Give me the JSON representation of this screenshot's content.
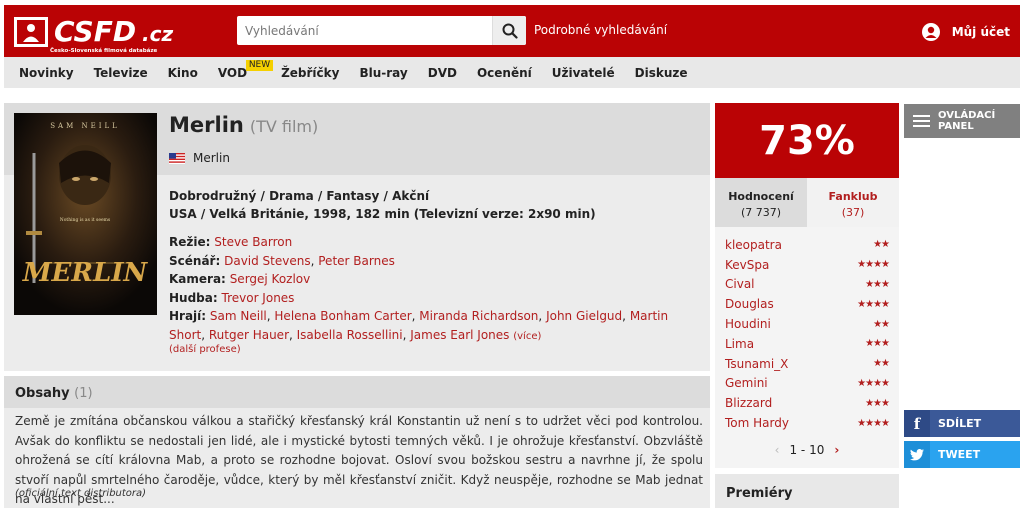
{
  "header": {
    "logo_text": "CSFD.cz",
    "logo_subtitle": "Česko-Slovenská filmová databáze",
    "search_placeholder": "Vyhledávání",
    "advanced_search": "Podrobné vyhledávání",
    "account": "Můj účet",
    "brand_color": "#ba0305"
  },
  "nav": {
    "items": [
      "Novinky",
      "Televize",
      "Kino",
      "VOD",
      "Žebříčky",
      "Blu-ray",
      "DVD",
      "Ocenění",
      "Uživatelé",
      "Diskuze"
    ],
    "vod_badge": "NEW"
  },
  "film": {
    "title": "Merlin",
    "type": "(TV film)",
    "original_name": "Merlin",
    "original_flag": "us-flag",
    "genres": "Dobrodružný / Drama / Fantasy / Akční",
    "origin": "USA / Velká Británie, 1998, 182 min (Televizní verze: 2x90 min)",
    "poster_actor": "SAM NEILL",
    "poster_title": "MERLIN",
    "poster_tagline": "Nothing is as it seems",
    "director_label": "Režie:",
    "directors": [
      "Steve Barron"
    ],
    "writer_label": "Scénář:",
    "writers": [
      "David Stevens",
      "Peter Barnes"
    ],
    "camera_label": "Kamera:",
    "camera": [
      "Sergej Kozlov"
    ],
    "music_label": "Hudba:",
    "music": [
      "Trevor Jones"
    ],
    "cast_label": "Hrají:",
    "cast": [
      "Sam Neill",
      "Helena Bonham Carter",
      "Miranda Richardson",
      "John Gielgud",
      "Martin Short",
      "Rutger Hauer",
      "Isabella Rossellini",
      "James Earl Jones"
    ],
    "cast_more": "(více)",
    "more_professions": "(další profese)"
  },
  "plot": {
    "title": "Obsahy",
    "count": "(1)",
    "text": "Země je zmítána občanskou válkou a stařičký křesťanský král Konstantin už není s to udržet věci pod kontrolou. Avšak do konfliktu se nedostali jen lidé, ale i mystické bytosti temných věků. I je ohrožuje křesťanství. Obzvláště ohrožená se cítí královna Mab, a proto se rozhodne bojovat. Osloví svou božskou sestru a navrhne jí, že spolu stvoří napůl smrtelného čaroděje, vůdce, který by měl křesťanství zničit. Když neuspěje, rozhodne se Mab jednat na vlastní pěst...",
    "source": "(oficiální text distributora)"
  },
  "rating": {
    "percent": "73%",
    "tab_ratings": "Hodnocení",
    "tab_ratings_count": "(7 737)",
    "tab_fanclub": "Fanklub",
    "tab_fanclub_count": "(37)",
    "users": [
      {
        "name": "kleopatra",
        "stars": "★★"
      },
      {
        "name": "KevSpa",
        "stars": "★★★★"
      },
      {
        "name": "Cival",
        "stars": "★★★"
      },
      {
        "name": "Douglas",
        "stars": "★★★★"
      },
      {
        "name": "Houdini",
        "stars": "★★"
      },
      {
        "name": "Lima",
        "stars": "★★★"
      },
      {
        "name": "Tsunami_X",
        "stars": "★★"
      },
      {
        "name": "Gemini",
        "stars": "★★★★"
      },
      {
        "name": "Blizzard",
        "stars": "★★★"
      },
      {
        "name": "Tom Hardy",
        "stars": "★★★★"
      }
    ],
    "pager_prev": "‹",
    "pager_range": "1 - 10",
    "pager_next": "›"
  },
  "sidebar": {
    "panel_label": "OVLÁDACÍ PANEL",
    "share_label": "SDÍLET",
    "tweet_label": "TWEET",
    "premieres": "Premiéry"
  }
}
